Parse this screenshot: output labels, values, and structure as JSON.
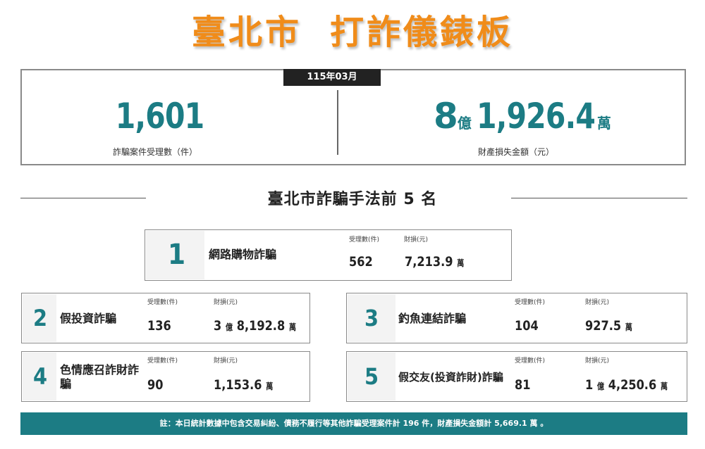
{
  "title": {
    "part1": "臺北市",
    "part2": "打詐儀錶板"
  },
  "period": "115年03月",
  "summary": {
    "cases": {
      "value": "1,601",
      "label": "詐騙案件受理數（件）"
    },
    "loss": {
      "yi": "8",
      "yi_unit": "億",
      "wan": "1,926.4",
      "wan_unit": "萬",
      "label": "財產損失金額（元）"
    }
  },
  "section_title": "臺北市詐騙手法前 5 名",
  "col_headers": {
    "cases": "受理數(件)",
    "loss": "財損(元)"
  },
  "methods": [
    {
      "rank": "1",
      "name": "網路購物詐騙",
      "cases": "562",
      "loss": "7,213.9",
      "loss_unit": "萬"
    },
    {
      "rank": "2",
      "name": "假投資詐騙",
      "cases": "136",
      "loss_yi": "3",
      "yi_unit": "億",
      "loss": "8,192.8",
      "loss_unit": "萬"
    },
    {
      "rank": "3",
      "name": "釣魚連結詐騙",
      "cases": "104",
      "loss": "927.5",
      "loss_unit": "萬"
    },
    {
      "rank": "4",
      "name_line1": "色情應召詐財詐",
      "name_line2": "騙",
      "cases": "90",
      "loss": "1,153.6",
      "loss_unit": "萬"
    },
    {
      "rank": "5",
      "name": "假交友(投資詐財)詐騙",
      "cases": "81",
      "loss_yi": "1",
      "yi_unit": "億",
      "loss": "4,250.6",
      "loss_unit": "萬"
    }
  ],
  "footer": "註：本日統計數據中包含交易糾紛、債務不履行等其他詐騙受理案件計 196 件，財產損失金額計 5,669.1 萬 。",
  "colors": {
    "accent": "#1c7c84",
    "title": "#f08c1a"
  }
}
